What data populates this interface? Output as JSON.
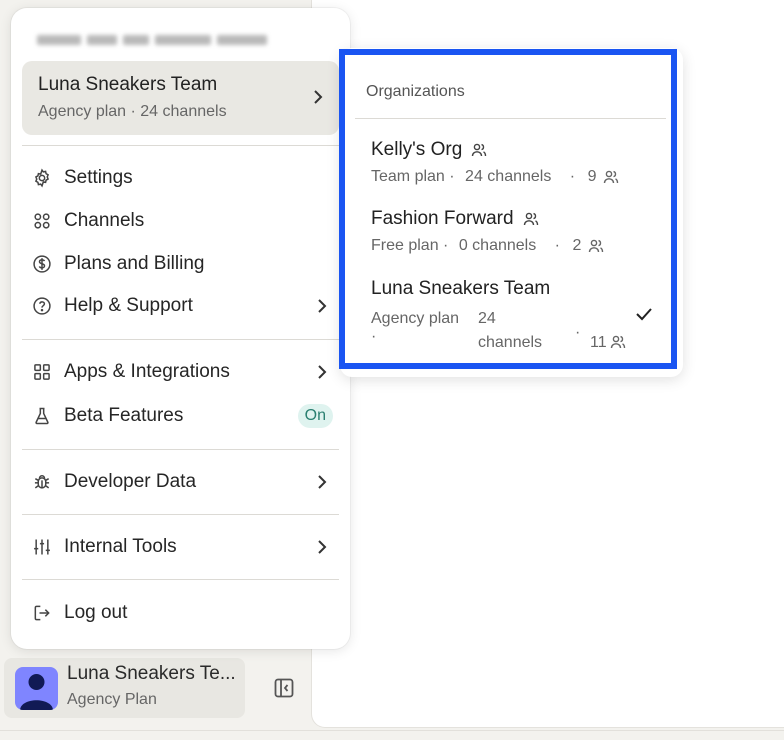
{
  "menu": {
    "email_obscured": "blurred account email",
    "current_org": {
      "name": "Luna Sneakers Team",
      "subtitle": "Agency plan · 24 channels"
    },
    "items": [
      {
        "label": "Settings",
        "icon": "gear-icon"
      },
      {
        "label": "Channels",
        "icon": "grid-circles-icon"
      },
      {
        "label": "Plans and Billing",
        "icon": "dollar-icon"
      },
      {
        "label": "Help & Support",
        "icon": "question-icon"
      },
      {
        "label": "Apps & Integrations",
        "icon": "apps-icon"
      },
      {
        "label": "Beta Features",
        "icon": "flask-icon",
        "badge": "On"
      },
      {
        "label": "Developer Data",
        "icon": "bug-icon"
      },
      {
        "label": "Internal Tools",
        "icon": "sliders-icon"
      },
      {
        "label": "Log out",
        "icon": "logout-icon"
      }
    ]
  },
  "organizations": {
    "title": "Organizations",
    "list": [
      {
        "name": "Kelly's Org",
        "plan": "Team plan ·",
        "channels": "24 channels",
        "sep": "·",
        "members": "9"
      },
      {
        "name": "Fashion Forward",
        "plan": "Free plan ·",
        "channels": "0 channels",
        "sep": "·",
        "members": "2"
      },
      {
        "name": "Luna Sneakers Team",
        "plan": "Agency plan",
        "plan_dot": "·",
        "channels_a": "24",
        "channels_b": "channels",
        "sep": "·",
        "members": "11",
        "selected": true
      }
    ]
  },
  "profile": {
    "name": "Luna Sneakers Te...",
    "plan": "Agency Plan"
  },
  "colors": {
    "highlight": "#1a55f2",
    "badge_bg": "#dff3ef",
    "badge_text": "#2a7f70",
    "avatar": "#7f85ff"
  }
}
